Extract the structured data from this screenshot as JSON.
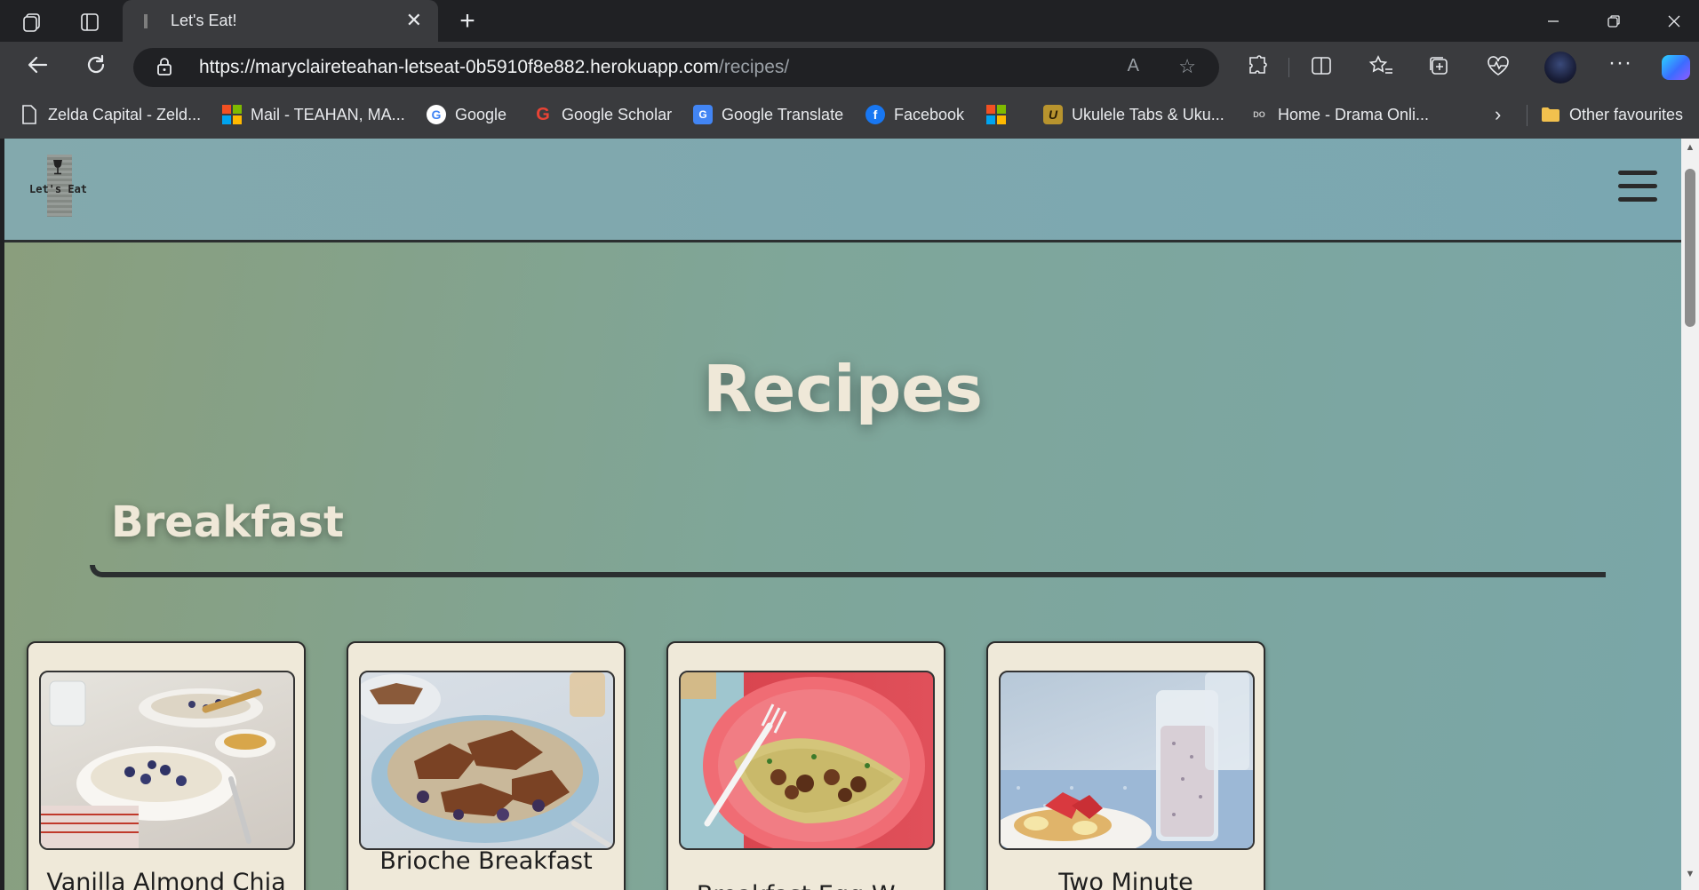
{
  "browser": {
    "tab_title": "Let's Eat!",
    "tab_close": "✕",
    "new_tab": "+",
    "url_host": "https://maryclaireteahan-letseat-0b5910f8e882.herokuapp.com",
    "url_path": "/recipes/",
    "read_aloud": "A",
    "bookmarks": [
      {
        "label": "Zelda Capital - Zeld..."
      },
      {
        "label": "Mail - TEAHAN, MA..."
      },
      {
        "label": "Google"
      },
      {
        "label": "Google Scholar"
      },
      {
        "label": "Google Translate"
      },
      {
        "label": "Facebook"
      },
      {
        "label": ""
      },
      {
        "label": "Ukulele Tabs & Uku..."
      },
      {
        "label": "Home - Drama Onli..."
      }
    ],
    "other_favourites": "Other favourites",
    "colors": {
      "chrome_dark": "#202124",
      "chrome_mid": "#3a3b3e"
    }
  },
  "site": {
    "logo_text": "Let's Eat",
    "page_title": "Recipes",
    "section": "Breakfast",
    "recipes": [
      {
        "title": "Vanilla Almond Chia",
        "image": "vanilla-almond-chia-photo"
      },
      {
        "title": "Brioche Breakfast",
        "image": "brioche-breakfast-photo"
      },
      {
        "title": "Breakfast Egg W...",
        "image": "breakfast-egg-wrap-photo"
      },
      {
        "title": "Two Minute",
        "image": "two-minute-smoothie-photo"
      }
    ],
    "colors": {
      "header": "#7fa8ae",
      "title_text": "#efe8d8",
      "card_bg": "#efe9d9"
    }
  }
}
